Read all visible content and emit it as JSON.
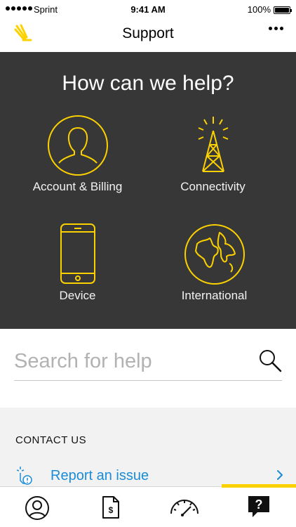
{
  "status_bar": {
    "carrier": "Sprint",
    "time": "9:41 AM",
    "battery": "100%"
  },
  "nav": {
    "title": "Support",
    "logo_icon": "sprint-logo",
    "more_icon": "more-dots-icon"
  },
  "help": {
    "title": "How can we help?",
    "categories": [
      {
        "label": "Account & Billing",
        "icon": "person-circle-icon"
      },
      {
        "label": "Connectivity",
        "icon": "cell-tower-icon"
      },
      {
        "label": "Device",
        "icon": "phone-icon"
      },
      {
        "label": "International",
        "icon": "globe-icon"
      }
    ]
  },
  "search": {
    "placeholder": "Search for help",
    "icon": "search-icon"
  },
  "contact": {
    "heading": "CONTACT US",
    "report_label": "Report an issue",
    "report_icon": "report-issue-icon"
  },
  "tabbar": {
    "tabs": [
      "account-tab-icon",
      "bill-tab-icon",
      "usage-gauge-icon",
      "support-tab-icon"
    ],
    "active_index": 3
  },
  "colors": {
    "accent_yellow": "#fcd100",
    "hero_background": "#373737",
    "link_blue": "#1a8cd8"
  }
}
